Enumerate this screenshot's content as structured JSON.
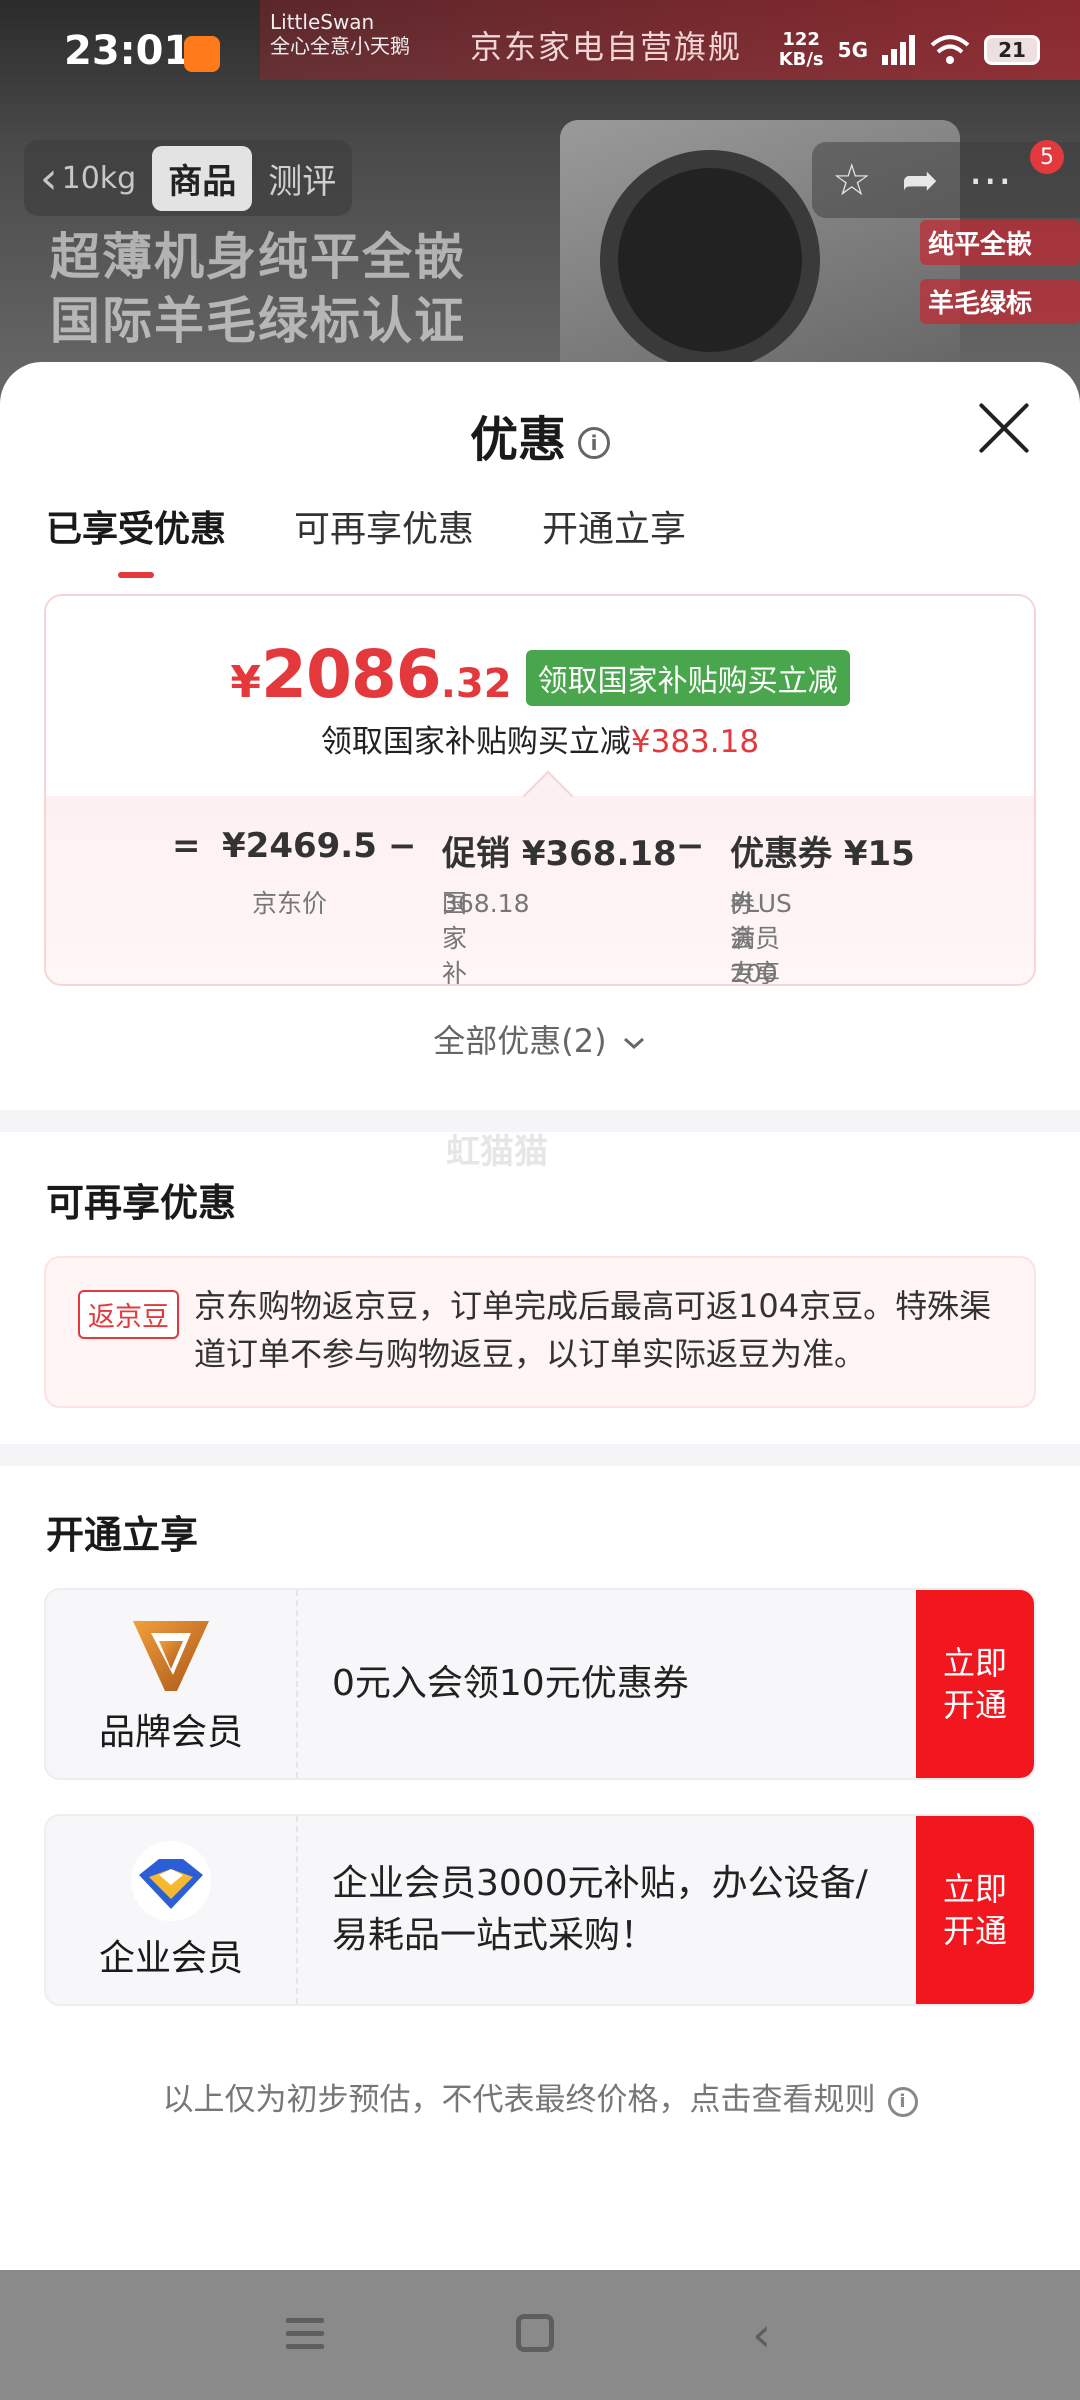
{
  "status_bar": {
    "time": "23:01",
    "net_speed_value": "122",
    "net_speed_unit": "KB/s",
    "signal_label": "5G",
    "battery": "21"
  },
  "product_header": {
    "brand_line1": "LittleSwan",
    "brand_line2": "全心全意小天鹅",
    "banner_text": "京东家电自营旗舰",
    "back_text": "10kg",
    "tab_goods": "商品",
    "tab_review": "测评",
    "headline_line1": "超薄机身纯平全嵌",
    "headline_line2": "国际羊毛绿标认证",
    "cart_count": "5",
    "side_badge_1": "纯平全嵌",
    "side_badge_2": "羊毛绿标",
    "icons": [
      "star-icon",
      "share-icon",
      "more-icon"
    ]
  },
  "sheet": {
    "title": "优惠",
    "tabs": [
      "已享受优惠",
      "可再享优惠",
      "开通立享"
    ],
    "active_tab": 0,
    "price": {
      "yen": "¥",
      "integer": "2086",
      "decimal": ".32",
      "tag": "领取国家补贴购买立减",
      "sub_text": "领取国家补贴购买立减",
      "sub_amount": "¥383.18"
    },
    "calc": {
      "equals": "=",
      "jd_price": "¥2469.5",
      "minus1": "−",
      "promo": "促销 ¥368.18",
      "minus2": "−",
      "coupon": "优惠券 ¥15",
      "jd_price_label": "京东价",
      "promo_label_1": "国家补贴减",
      "promo_label_2": "368.18",
      "coupon_label_1": "PLUS会员专享",
      "coupon_label_2": "券满200减15"
    },
    "all_offers": "全部优惠(2)",
    "watermark": "虹猫猫",
    "more_section": {
      "title": "可再享优惠",
      "bean_tag": "返京豆",
      "bean_text": "京东购物返京豆，订单完成后最高可返104京豆。特殊渠道订单不参与购物返豆，以订单实际返豆为准。"
    },
    "open_section": {
      "title": "开通立享",
      "members": [
        {
          "name": "品牌会员",
          "desc": "0元入会领10元优惠券",
          "button": "立即开通"
        },
        {
          "name": "企业会员",
          "desc": "企业会员3000元补贴，办公设备/易耗品一站式采购！",
          "button": "立即开通"
        }
      ]
    },
    "footer_note": "以上仅为初步预估，不代表最终价格，点击查看规则"
  },
  "colors": {
    "accent_red": "#e4393c",
    "button_red": "#f2161f",
    "tag_green": "#49a64c"
  }
}
